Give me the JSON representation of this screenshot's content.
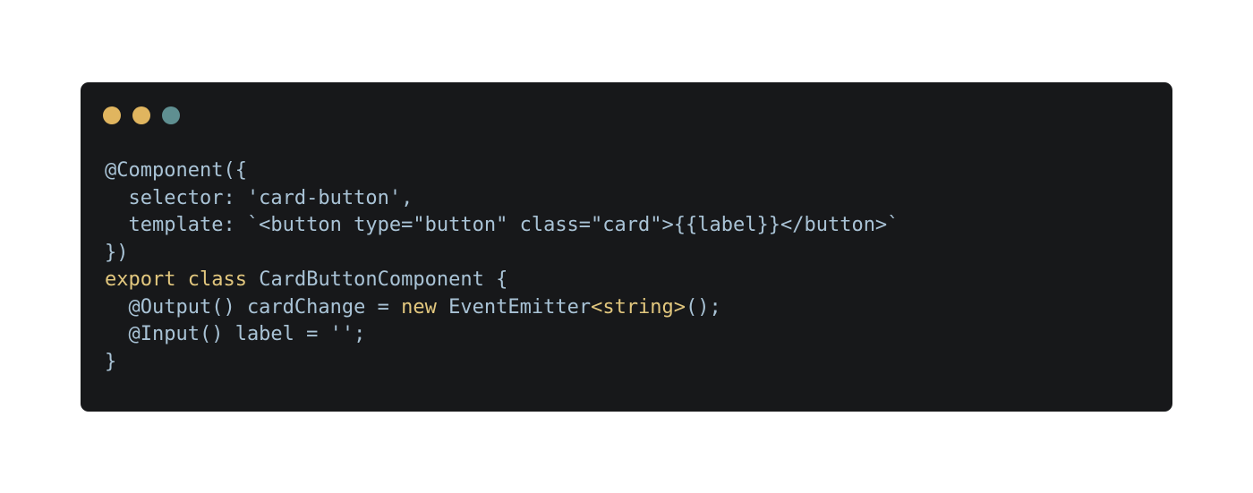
{
  "window": {
    "dots": [
      {
        "name": "close-dot",
        "color": "#e0b55f"
      },
      {
        "name": "minimize-dot",
        "color": "#e0b55f"
      },
      {
        "name": "maximize-dot",
        "color": "#5f8f91"
      }
    ]
  },
  "colors": {
    "background": "#17181a",
    "text": "#a9c3d6",
    "keyword": "#e2c77e"
  },
  "code": {
    "lines": [
      [
        {
          "t": "@Component({",
          "c": "plain"
        }
      ],
      [
        {
          "t": "  selector: 'card-button',",
          "c": "plain"
        }
      ],
      [
        {
          "t": "  template: `<button type=\"button\" class=\"card\">{{label}}</button>`",
          "c": "plain"
        }
      ],
      [
        {
          "t": "})",
          "c": "plain"
        }
      ],
      [
        {
          "t": "export",
          "c": "kw"
        },
        {
          "t": " ",
          "c": "plain"
        },
        {
          "t": "class",
          "c": "kw"
        },
        {
          "t": " CardButtonComponent {",
          "c": "plain"
        }
      ],
      [
        {
          "t": "  @Output() cardChange = ",
          "c": "plain"
        },
        {
          "t": "new",
          "c": "kw"
        },
        {
          "t": " EventEmitter",
          "c": "plain"
        },
        {
          "t": "<string>",
          "c": "kw"
        },
        {
          "t": "();",
          "c": "plain"
        }
      ],
      [
        {
          "t": "  @Input() label = '';",
          "c": "plain"
        }
      ],
      [
        {
          "t": "}",
          "c": "plain"
        }
      ]
    ]
  }
}
